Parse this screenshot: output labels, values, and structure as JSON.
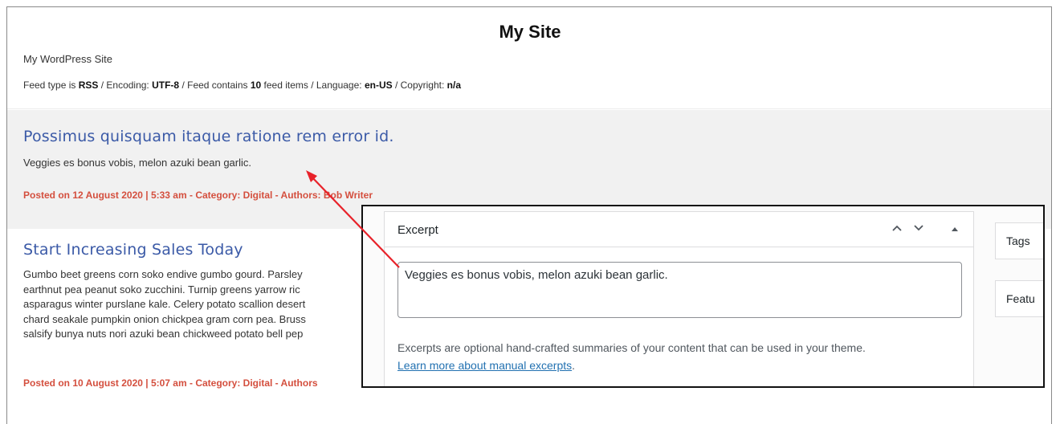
{
  "site": {
    "title": "My Site",
    "description": "My WordPress Site"
  },
  "feed_meta": {
    "type_label": "Feed type is ",
    "type": "RSS",
    "encoding_label": " / Encoding: ",
    "encoding": "UTF-8",
    "contains_label": " / Feed contains ",
    "count": "10",
    "items_label": " feed items / Language: ",
    "language": "en-US",
    "copyright_label": " / Copyright: ",
    "copyright": "n/a"
  },
  "posts": [
    {
      "title": "Possimus quisquam itaque ratione rem error id.",
      "excerpt": "Veggies es bonus vobis, melon azuki bean garlic.",
      "meta": "Posted on 12 August 2020 | 5:33 am - Category: Digital - Authors: Bob Writer"
    },
    {
      "title": "Start Increasing Sales Today",
      "lines": [
        "Gumbo beet greens corn soko endive gumbo gourd. Parsley",
        "earthnut pea peanut soko zucchini. Turnip greens yarrow ric",
        "asparagus winter purslane kale. Celery potato scallion desert",
        "chard seakale pumpkin onion chickpea gram corn pea. Bruss",
        "salsify bunya nuts nori azuki bean chickweed potato bell pep"
      ],
      "meta": "Posted on 10 August 2020 | 5:07 am - Category: Digital - Authors"
    }
  ],
  "excerpt_panel": {
    "title": "Excerpt",
    "value": "Veggies es bonus vobis, melon azuki bean garlic.",
    "help_text": "Excerpts are optional hand-crafted summaries of your content that can be used in your theme.",
    "help_link": "Learn more about manual excerpts",
    "help_link_suffix": ".",
    "side_tags": "Tags",
    "side_featured": "Featu"
  },
  "colors": {
    "post_title": "#3b5aa7",
    "post_meta": "#d44f3e",
    "highlight_bg": "#f1f1f1",
    "arrow": "#e8222a",
    "link": "#2271b1"
  },
  "icons": [
    "chevron-up-icon",
    "chevron-down-icon",
    "triangle-up-icon"
  ]
}
